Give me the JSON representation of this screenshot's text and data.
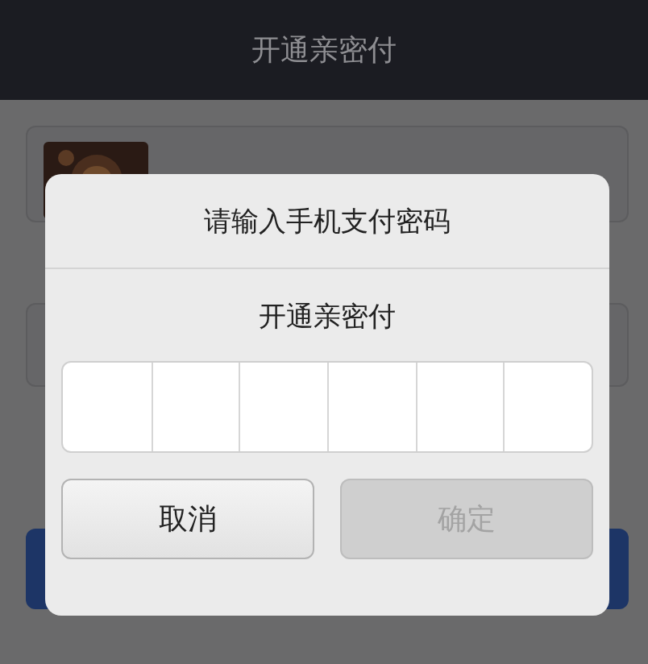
{
  "nav_bar": {
    "title": "开通亲密付"
  },
  "dialog": {
    "title": "请输入手机支付密码",
    "subtitle": "开通亲密付",
    "buttons": [
      {
        "label": "取消",
        "disabled": false
      },
      {
        "label": "确定",
        "disabled": true
      }
    ]
  }
}
